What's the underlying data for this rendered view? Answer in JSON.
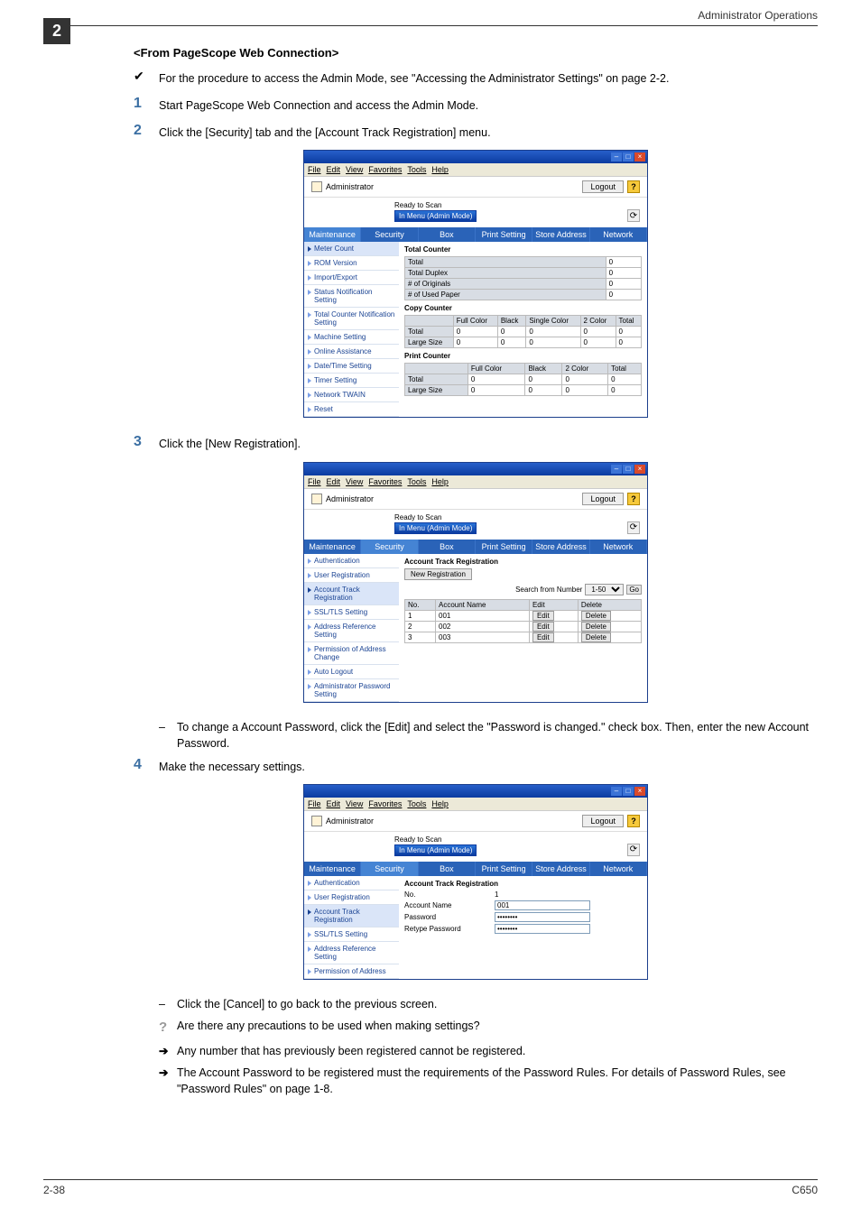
{
  "header": {
    "chapter_tab": "2",
    "right_text": "Administrator Operations"
  },
  "section_title": "<From PageScope Web Connection>",
  "intro": {
    "bullet": "✔",
    "text": "For the procedure to access the Admin Mode, see \"Accessing the Administrator Settings\" on page 2-2."
  },
  "steps": {
    "s1": {
      "num": "1",
      "text": "Start PageScope Web Connection and access the Admin Mode."
    },
    "s2": {
      "num": "2",
      "text": "Click the [Security] tab and the [Account Track Registration] menu."
    },
    "s3": {
      "num": "3",
      "text": "Click the [New Registration]."
    },
    "s3_note": "To change a Account Password, click the [Edit] and select the \"Password is changed.\" check box. Then, enter the new Account Password.",
    "s4": {
      "num": "4",
      "text": "Make the necessary settings."
    }
  },
  "post": {
    "dash1": "Click the [Cancel] to go back to the previous screen.",
    "q": "Are there any precautions to be used when making settings?",
    "a1": "Any number that has previously been registered cannot be registered.",
    "a2": "The Account Password to be registered must the requirements of the Password Rules. For details of Password Rules, see \"Password Rules\" on page 1-8."
  },
  "window": {
    "menubar": [
      "File",
      "Edit",
      "View",
      "Favorites",
      "Tools",
      "Help"
    ],
    "admin_label": "Administrator",
    "logout": "Logout",
    "help": "?",
    "status_ready": "Ready to Scan",
    "status_location": "In Menu (Admin Mode)",
    "tabs": [
      "Maintenance",
      "Security",
      "Box",
      "Print Setting",
      "Store Address",
      "Network"
    ]
  },
  "screenshot1": {
    "sidebar": [
      "Meter Count",
      "ROM Version",
      "Import/Export",
      "Status Notification Setting",
      "Total Counter Notification Setting",
      "Machine Setting",
      "Online Assistance",
      "Date/Time Setting",
      "Timer Setting",
      "Network TWAIN",
      "Reset"
    ],
    "pane_title": "Total Counter",
    "total_rows": [
      {
        "label": "Total",
        "v": "0"
      },
      {
        "label": "Total Duplex",
        "v": "0"
      },
      {
        "label": "# of Originals",
        "v": "0"
      },
      {
        "label": "# of Used Paper",
        "v": "0"
      }
    ],
    "copy_title": "Copy Counter",
    "copy_cols": [
      "",
      "Full Color",
      "Black",
      "Single Color",
      "2 Color",
      "Total"
    ],
    "copy_rows": [
      {
        "label": "Total",
        "cells": [
          "0",
          "0",
          "0",
          "0",
          "0"
        ]
      },
      {
        "label": "Large Size",
        "cells": [
          "0",
          "0",
          "0",
          "0",
          "0"
        ]
      }
    ],
    "print_title": "Print Counter",
    "print_cols": [
      "",
      "Full Color",
      "Black",
      "2 Color",
      "Total"
    ],
    "print_rows": [
      {
        "label": "Total",
        "cells": [
          "0",
          "0",
          "0",
          "0"
        ]
      },
      {
        "label": "Large Size",
        "cells": [
          "0",
          "0",
          "0",
          "0"
        ]
      }
    ]
  },
  "screenshot2": {
    "sidebar": [
      "Authentication",
      "User Registration",
      "Account Track Registration",
      "SSL/TLS Setting",
      "Address Reference Setting",
      "Permission of Address Change",
      "Auto Logout",
      "Administrator Password Setting"
    ],
    "pane_title": "Account Track Registration",
    "new_reg": "New Registration",
    "search_label": "Search from Number",
    "search_range": "1-50",
    "go": "Go",
    "table_cols": [
      "No.",
      "Account Name",
      "Edit",
      "Delete"
    ],
    "rows": [
      {
        "no": "1",
        "name": "001"
      },
      {
        "no": "2",
        "name": "002"
      },
      {
        "no": "3",
        "name": "003"
      }
    ],
    "edit_btn": "Edit",
    "delete_btn": "Delete"
  },
  "screenshot3": {
    "sidebar": [
      "Authentication",
      "User Registration",
      "Account Track Registration",
      "SSL/TLS Setting",
      "Address Reference Setting",
      "Permission of Address"
    ],
    "pane_title": "Account Track Registration",
    "fields": {
      "no_label": "No.",
      "no_value": "1",
      "name_label": "Account Name",
      "name_value": "001",
      "pw_label": "Password",
      "pw_value": "••••••••",
      "rpw_label": "Retype Password",
      "rpw_value": "••••••••"
    }
  },
  "footer": {
    "left": "2-38",
    "right": "C650"
  }
}
